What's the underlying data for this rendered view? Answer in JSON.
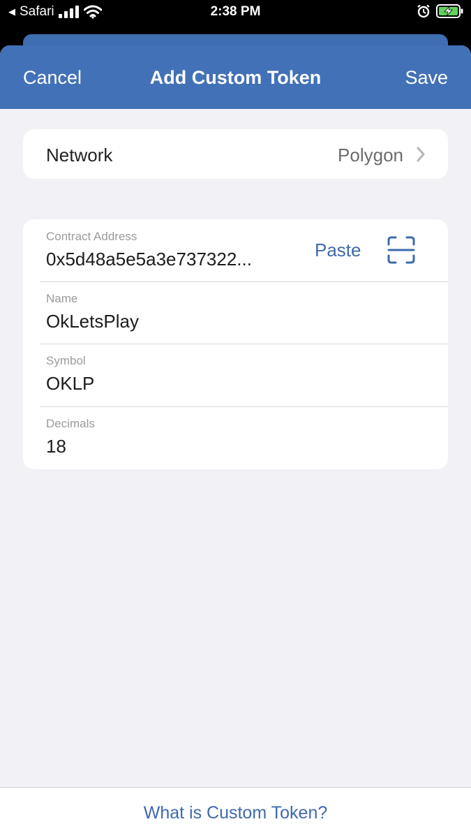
{
  "status_bar": {
    "back_app": "Safari",
    "time": "2:38 PM"
  },
  "nav": {
    "cancel_label": "Cancel",
    "title": "Add Custom Token",
    "save_label": "Save"
  },
  "network": {
    "label": "Network",
    "value": "Polygon"
  },
  "fields": {
    "contract_address": {
      "label": "Contract Address",
      "value": "0x5d48a5e5a3e737322...",
      "paste_label": "Paste"
    },
    "name": {
      "label": "Name",
      "value": "OkLetsPlay"
    },
    "symbol": {
      "label": "Symbol",
      "value": "OKLP"
    },
    "decimals": {
      "label": "Decimals",
      "value": "18"
    }
  },
  "footer": {
    "help_link": "What is Custom Token?"
  },
  "colors": {
    "nav_bg": "#4271b7",
    "accent": "#3e6aac",
    "page_bg": "#f1f1f6",
    "battery_green": "#5fd35a"
  },
  "icons": {
    "scan": "scan-qr-icon",
    "chevron": "chevron-right-icon",
    "signal": "signal-bars-icon",
    "wifi": "wifi-icon",
    "alarm": "alarm-icon",
    "battery": "battery-charging-icon"
  }
}
